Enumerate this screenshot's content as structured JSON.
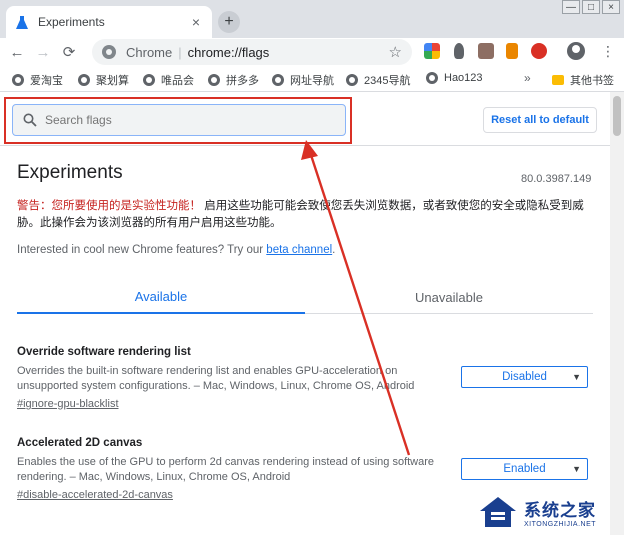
{
  "browser": {
    "tab_title": "Experiments",
    "close_glyph": "×",
    "newtab_glyph": "+",
    "window_buttons": [
      "—",
      "□",
      "×"
    ],
    "omnibox": {
      "site_label": "Chrome",
      "separator": "|",
      "url": "chrome://flags"
    },
    "nav": {
      "back": "←",
      "forward": "→",
      "reload": "⟳"
    },
    "star_glyph": "☆",
    "menu_glyph": "⋮",
    "extensions": [
      {
        "name": "colorful-extension-icon",
        "color": "#34a853"
      },
      {
        "name": "lightbulb-extension-icon",
        "color": "#5f6368"
      },
      {
        "name": "owl-extension-icon",
        "color": "#8d6e63"
      },
      {
        "name": "tool-extension-icon",
        "color": "#ea8600"
      },
      {
        "name": "abp-extension-icon",
        "color": "#d93025"
      }
    ]
  },
  "bookmarks": {
    "items": [
      "爱淘宝",
      "聚划算",
      "唯品会",
      "拼多多",
      "网址导航",
      "2345导航",
      "Hao123"
    ],
    "more": "»",
    "other_folder": "其他书签"
  },
  "page": {
    "search_placeholder": "Search flags",
    "reset_label": "Reset all to default",
    "title": "Experiments",
    "version": "80.0.3987.149",
    "warning_prefix": "警告：您所要使用的是实验性功能！",
    "warning_body": "启用这些功能可能会致使您丢失浏览数据，或者致使您的安全或隐私受到威胁。此操作会为该浏览器的所有用户启用这些功能。",
    "interest_text": "Interested in cool new Chrome features? Try our",
    "interest_link": "beta channel",
    "interest_end": ".",
    "tabs": {
      "available": "Available",
      "unavailable": "Unavailable"
    },
    "flags": [
      {
        "name": "Override software rendering list",
        "description": "Overrides the built-in software rendering list and enables GPU-acceleration on unsupported system configurations. – Mac, Windows, Linux, Chrome OS, Android",
        "link": "#ignore-gpu-blacklist",
        "value": "Disabled"
      },
      {
        "name": "Accelerated 2D canvas",
        "description": "Enables the use of the GPU to perform 2d canvas rendering instead of using software rendering. – Mac, Windows, Linux, Chrome OS, Android",
        "link": "#disable-accelerated-2d-canvas",
        "value": "Enabled"
      }
    ],
    "caret_glyph": "▼"
  },
  "watermark": {
    "cn": "系统之家",
    "en": "XITONGZHIJIA.NET"
  },
  "colors": {
    "accent": "#1a73e8",
    "annotation": "#d93025",
    "warning": "#c5221f"
  }
}
